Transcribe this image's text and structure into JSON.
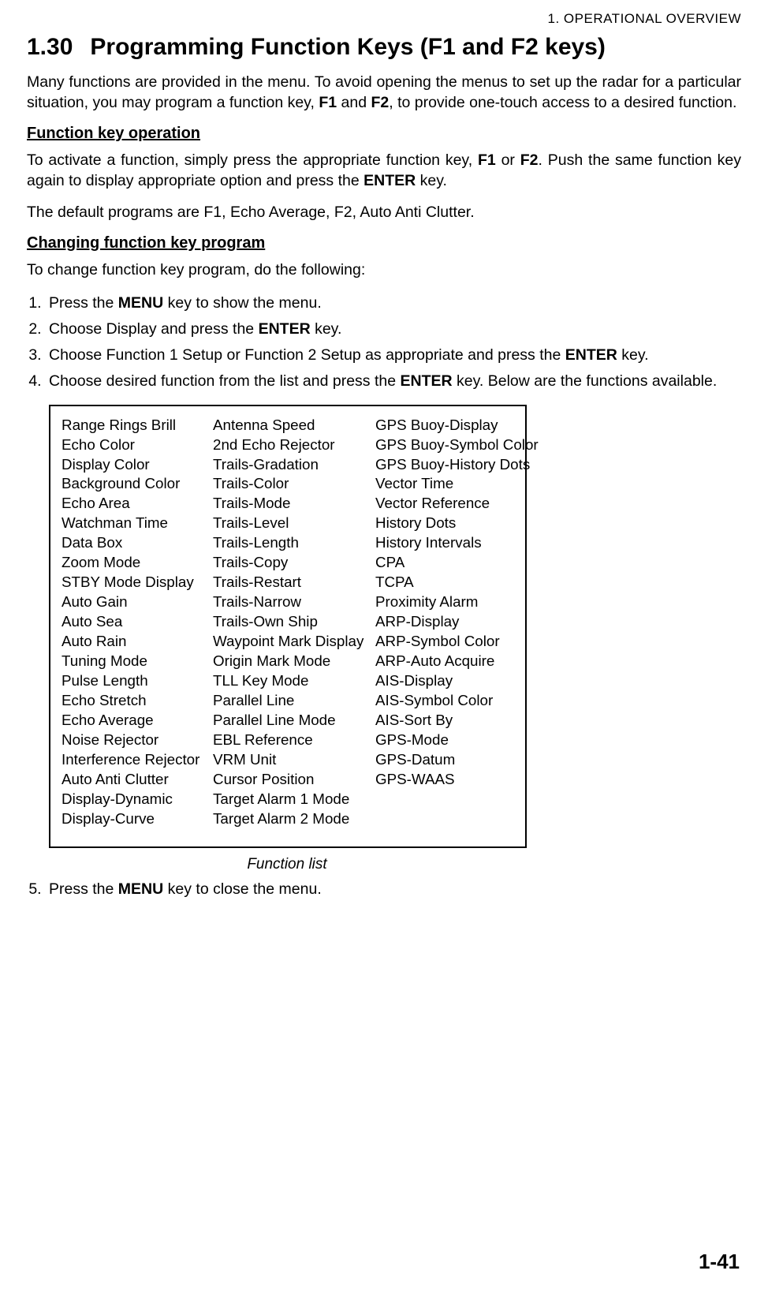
{
  "header": {
    "running": "1. OPERATIONAL OVERVIEW"
  },
  "section": {
    "number": "1.30",
    "title": "Programming Function Keys (F1 and F2 keys)"
  },
  "intro": {
    "t1": "Many functions are provided in the menu. To avoid opening the menus to set up the radar for a particular situation, you may program a function key, ",
    "b1": "F1",
    "t2": " and ",
    "b2": "F2",
    "t3": ", to provide one-touch access to a desired function."
  },
  "sub1": {
    "heading": "Function key operation",
    "p1_t1": "To activate a function, simply press the appropriate function key, ",
    "p1_b1": "F1",
    "p1_t2": " or ",
    "p1_b2": "F2",
    "p1_t3": ". Push the same function key again to display appropriate option and press the ",
    "p1_b3": "ENTER",
    "p1_t4": " key.",
    "p2": "The default programs are F1, Echo Average, F2, Auto Anti Clutter."
  },
  "sub2": {
    "heading": "Changing function key program",
    "p1": "To change function key program, do the following:"
  },
  "steps": {
    "s1_t1": "Press the ",
    "s1_b1": "MENU",
    "s1_t2": " key to show the menu.",
    "s2_t1": "Choose Display and press the ",
    "s2_b1": "ENTER",
    "s2_t2": " key.",
    "s3_t1": "Choose Function 1 Setup or Function 2 Setup as appropriate and press the ",
    "s3_b1": "ENTER",
    "s3_t2": " key.",
    "s4_t1": "Choose desired function from the list and press the ",
    "s4_b1": "ENTER",
    "s4_t2": " key. Below are the functions available.",
    "s5_t1": "Press the ",
    "s5_b1": "MENU",
    "s5_t2": " key to close the menu."
  },
  "functions": {
    "col1": [
      "Range Rings Brill",
      "Echo Color",
      "Display Color",
      "Background Color",
      "Echo Area",
      "Watchman Time",
      "Data Box",
      "Zoom Mode",
      "STBY Mode Display",
      "Auto Gain",
      "Auto Sea",
      "Auto Rain",
      "Tuning Mode",
      "Pulse Length",
      "Echo Stretch",
      "Echo Average",
      "Noise Rejector",
      "Interference Rejector",
      "Auto Anti Clutter",
      "Display-Dynamic",
      "Display-Curve"
    ],
    "col2": [
      "Antenna Speed",
      "2nd Echo Rejector",
      "Trails-Gradation",
      "Trails-Color",
      "Trails-Mode",
      "Trails-Level",
      "Trails-Length",
      "Trails-Copy",
      "Trails-Restart",
      "Trails-Narrow",
      "Trails-Own Ship",
      "Waypoint Mark Display",
      "Origin Mark Mode",
      "TLL Key Mode",
      "Parallel Line",
      "Parallel Line Mode",
      "EBL Reference",
      "VRM Unit",
      "Cursor Position",
      "Target Alarm 1 Mode",
      "Target Alarm 2 Mode"
    ],
    "col3": [
      "GPS Buoy-Display",
      "GPS Buoy-Symbol Color",
      "GPS Buoy-History Dots",
      "Vector Time",
      "Vector Reference",
      "History Dots",
      "History Intervals",
      "CPA",
      "TCPA",
      "Proximity Alarm",
      "ARP-Display",
      "ARP-Symbol Color",
      "ARP-Auto Acquire",
      "AIS-Display",
      "AIS-Symbol Color",
      "AIS-Sort By",
      "GPS-Mode",
      "GPS-Datum",
      "GPS-WAAS"
    ]
  },
  "caption": "Function list",
  "pageNumber": "1-41"
}
